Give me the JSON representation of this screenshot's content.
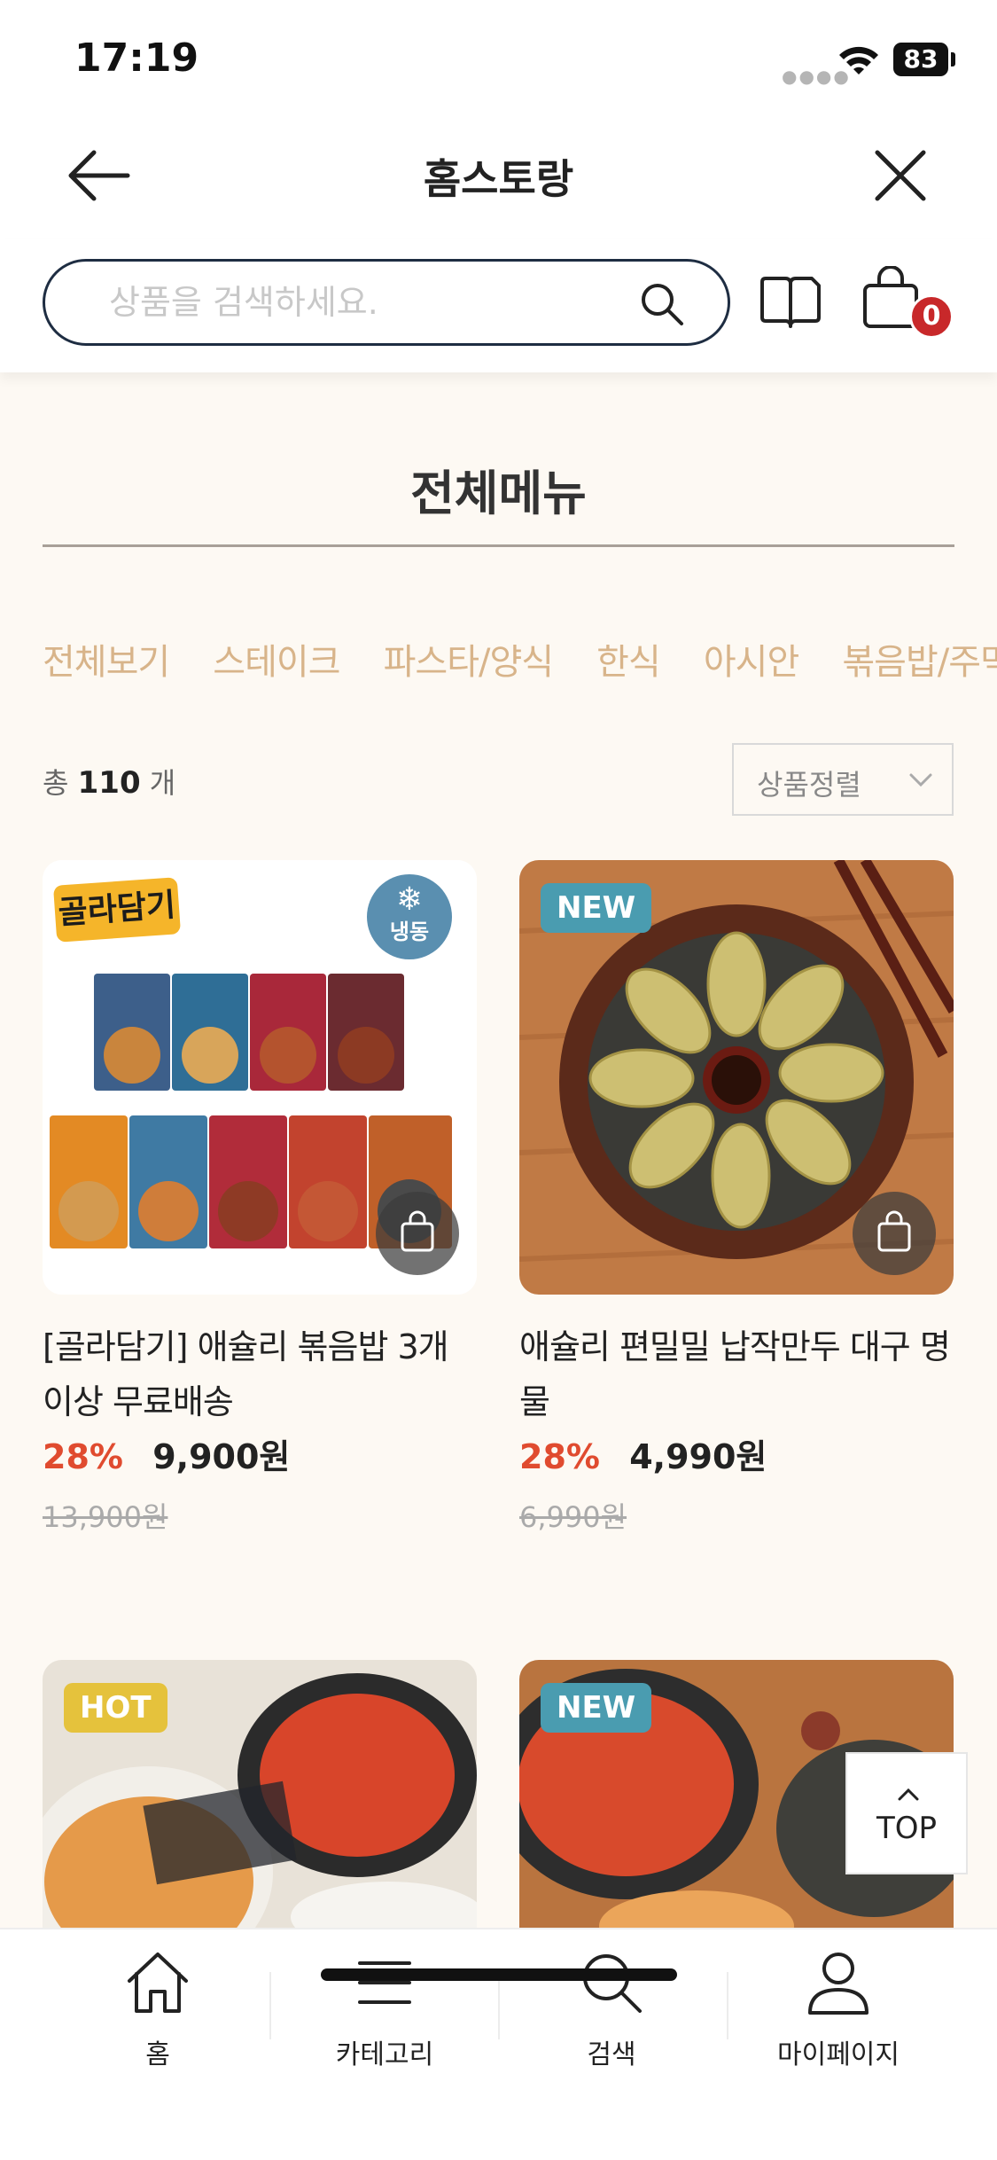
{
  "status": {
    "time": "17:19",
    "battery": "83"
  },
  "header": {
    "title": "홈스토랑"
  },
  "search": {
    "placeholder": "상품을 검색하세요.",
    "cart_count": "0"
  },
  "section": {
    "title": "전체메뉴"
  },
  "categories": [
    "전체보기",
    "스테이크",
    "파스타/양식",
    "한식",
    "아시안",
    "볶음밥/주먹밥"
  ],
  "listing": {
    "total_prefix": "총",
    "total": "110",
    "total_suffix": "개",
    "sort_label": "상품정렬"
  },
  "products": [
    {
      "name": "[골라담기] 애슐리 볶음밥 3개이상 무료배송",
      "discount": "28%",
      "price": "9,900원",
      "original_price": "13,900원",
      "brand_tag": "골라담기",
      "frozen_label": "냉동"
    },
    {
      "name": "애슐리 편밀밀 납작만두 대구 명물",
      "discount": "28%",
      "price": "4,990원",
      "original_price": "6,990원",
      "badge": "NEW"
    },
    {
      "badge": "HOT"
    },
    {
      "badge": "NEW"
    }
  ],
  "floating": {
    "top_label": "TOP"
  },
  "bottom_nav": [
    {
      "label": "홈",
      "icon": "home-icon"
    },
    {
      "label": "카테고리",
      "icon": "menu-icon"
    },
    {
      "label": "검색",
      "icon": "search-icon"
    },
    {
      "label": "마이페이지",
      "icon": "user-icon"
    }
  ]
}
